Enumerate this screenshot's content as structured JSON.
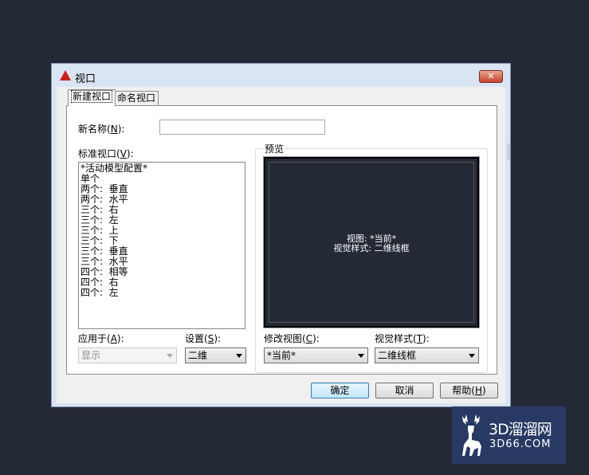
{
  "window": {
    "title": "视口",
    "close_label": "✕"
  },
  "tabs": [
    {
      "label": "新建视口",
      "active": true
    },
    {
      "label": "命名视口",
      "active": false
    }
  ],
  "new_name": {
    "label": "新名称",
    "hotkey": "N",
    "suffix": "):",
    "value": ""
  },
  "standard_viewports": {
    "label": "标准视口",
    "hotkey": "V",
    "suffix": "):",
    "items": [
      "*活动模型配置*",
      "单个",
      "两个:  垂直",
      "两个:  水平",
      "三个:  右",
      "三个:  左",
      "三个:  上",
      "三个:  下",
      "三个:  垂直",
      "三个:  水平",
      "四个:  相等",
      "四个:  右",
      "四个:  左"
    ]
  },
  "preview": {
    "label": "预览",
    "line1": "视图: *当前*",
    "line2": "视觉样式: 二维线框"
  },
  "apply_to": {
    "label": "应用于",
    "hotkey": "A",
    "suffix": "):",
    "value": "显示",
    "disabled": true
  },
  "setup": {
    "label": "设置",
    "hotkey": "S",
    "suffix": "):",
    "value": "二维"
  },
  "change_view": {
    "label": "修改视图",
    "hotkey": "C",
    "suffix": "):",
    "value": "*当前*"
  },
  "visual_style": {
    "label": "视觉样式",
    "hotkey": "T",
    "suffix": "):",
    "value": "二维线框"
  },
  "buttons": {
    "ok": "确定",
    "cancel": "取消",
    "help": "帮助",
    "help_hotkey": "H"
  },
  "watermark": {
    "line1": "3D溜溜网",
    "line2": "3D66.COM"
  }
}
